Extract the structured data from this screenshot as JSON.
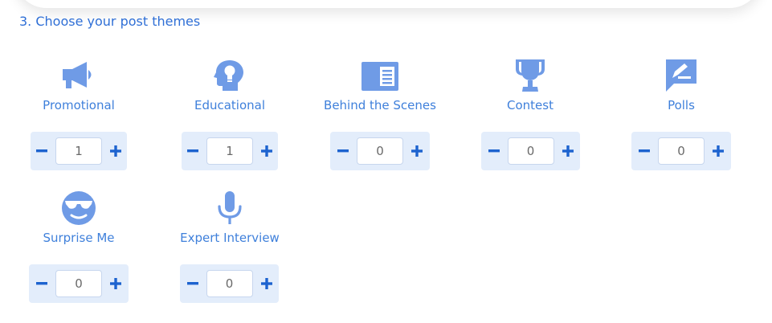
{
  "section": {
    "title": "3. Choose your post themes"
  },
  "colors": {
    "accent": "#2f6fd6",
    "icon": "#6f9be6",
    "stepper_bg": "#e3edfb"
  },
  "themes": [
    {
      "label": "Promotional",
      "icon": "megaphone-icon",
      "value": "1"
    },
    {
      "label": "Educational",
      "icon": "head-lightbulb-icon",
      "value": "1"
    },
    {
      "label": "Behind the Scenes",
      "icon": "article-icon",
      "value": "0"
    },
    {
      "label": "Contest",
      "icon": "trophy-icon",
      "value": "0"
    },
    {
      "label": "Polls",
      "icon": "poll-comment-icon",
      "value": "0"
    },
    {
      "label": "Surprise Me",
      "icon": "sunglasses-face-icon",
      "value": "0"
    },
    {
      "label": "Expert Interview",
      "icon": "microphone-icon",
      "value": "0"
    }
  ],
  "controls": {
    "decrement_icon": "minus-icon",
    "increment_icon": "plus-icon"
  }
}
